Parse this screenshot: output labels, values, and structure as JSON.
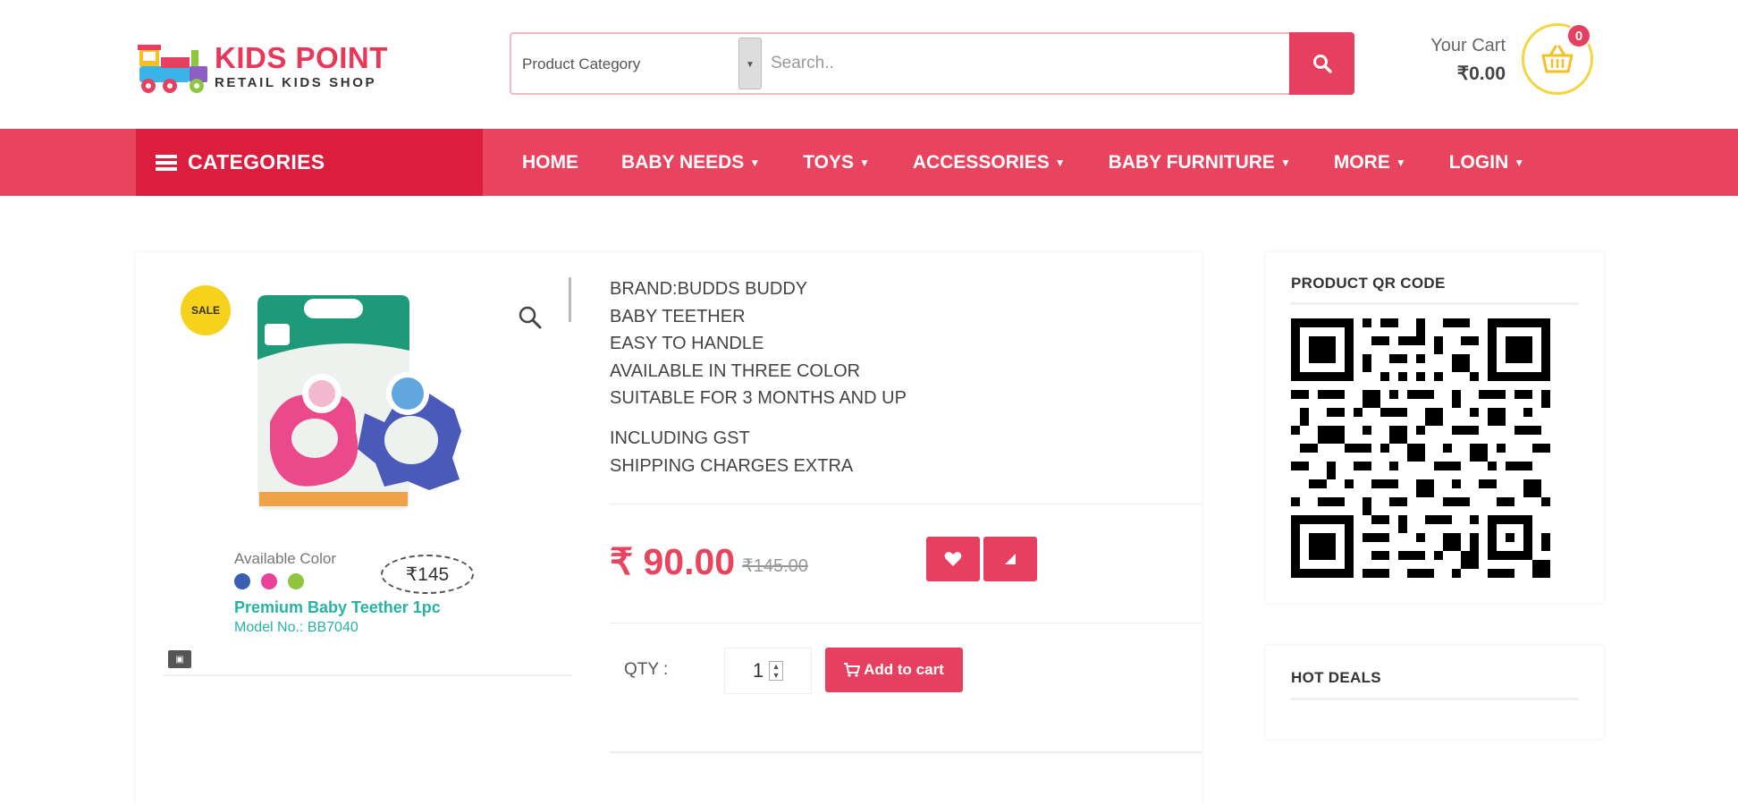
{
  "header": {
    "logo_title": "KIDS POINT",
    "logo_subtitle": "RETAIL  KIDS SHOP",
    "search": {
      "category_label": "Product Category",
      "placeholder": "Search.."
    },
    "cart": {
      "label": "Your Cart",
      "total": "₹0.00",
      "count": "0"
    }
  },
  "nav": {
    "categories_label": "CATEGORIES",
    "items": [
      {
        "label": "HOME",
        "dropdown": false
      },
      {
        "label": "BABY NEEDS",
        "dropdown": true
      },
      {
        "label": "TOYS",
        "dropdown": true
      },
      {
        "label": "ACCESSORIES",
        "dropdown": true
      },
      {
        "label": "BABY FURNITURE",
        "dropdown": true
      },
      {
        "label": "MORE",
        "dropdown": true
      },
      {
        "label": "LOGIN",
        "dropdown": true
      }
    ]
  },
  "product": {
    "sale_badge": "SALE",
    "image_text": {
      "available_color": "Available Color",
      "mrp": "₹145",
      "name": "Premium Baby Teether 1pc",
      "model": "Model No.: BB7040",
      "colors": [
        "#3a5fb0",
        "#e8429b",
        "#8ec63f"
      ]
    },
    "description": [
      "BRAND:BUDDS BUDDY",
      "BABY TEETHER",
      "EASY TO HANDLE",
      "AVAILABLE IN THREE COLOR",
      "SUITABLE FOR 3 MONTHS AND UP"
    ],
    "notes": [
      "INCLUDING GST",
      "SHIPPING CHARGES EXTRA"
    ],
    "price": "₹ 90.00",
    "old_price": "₹145.00",
    "qty_label": "QTY :",
    "qty_value": "1",
    "add_to_cart_label": "Add to cart"
  },
  "sidebar": {
    "qr_title": "PRODUCT QR CODE",
    "hot_deals_title": "HOT DEALS"
  },
  "colors": {
    "accent": "#e63f5f",
    "accent_dark": "#dc1e3e",
    "sale_yellow": "#f6d21d",
    "teal": "#27b3a4"
  }
}
